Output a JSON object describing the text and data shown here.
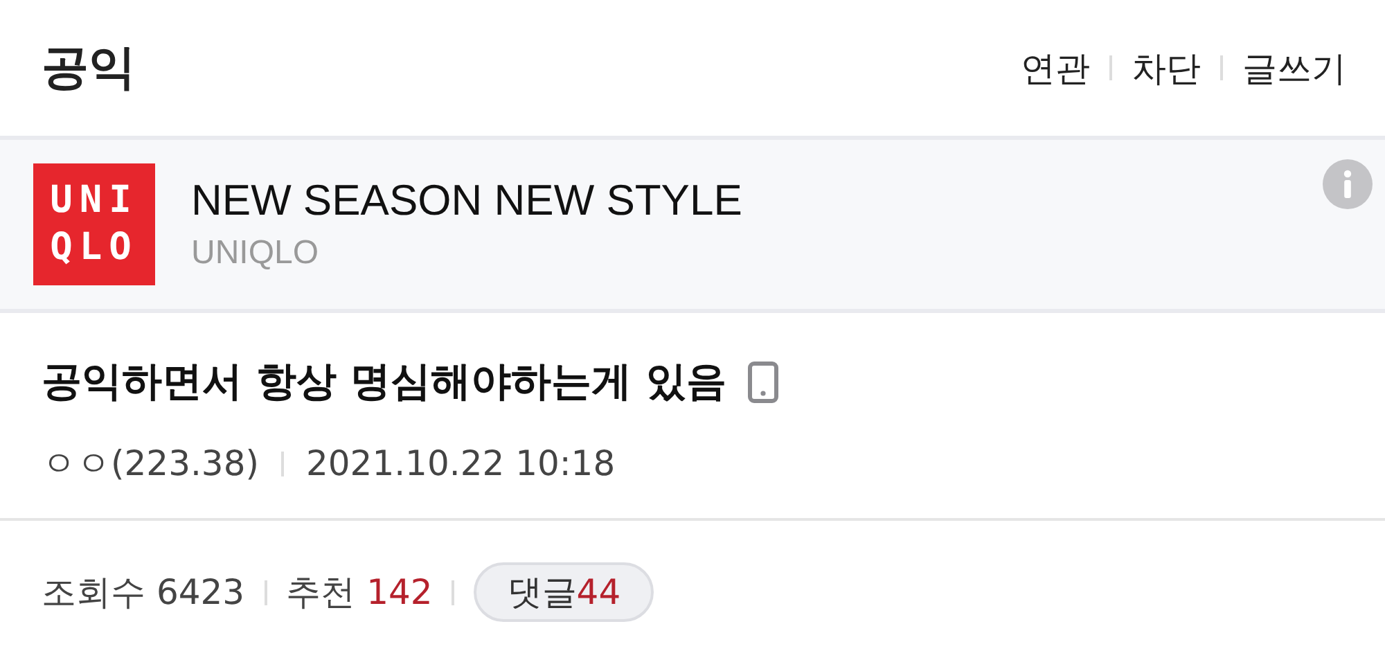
{
  "header": {
    "title": "공익",
    "actions": [
      "연관",
      "차단",
      "글쓰기"
    ]
  },
  "ad": {
    "logo_lines": [
      "UNI",
      "QLO"
    ],
    "headline": "NEW SEASON NEW STYLE",
    "advertiser": "UNIQLO"
  },
  "post": {
    "title": "공익하면서 항상 명심해야하는게 있음",
    "author": "ㅇㅇ(223.38)",
    "date": "2021.10.22 10:18"
  },
  "stats": {
    "views_label": "조회수",
    "views": "6423",
    "recommend_label": "추천",
    "recommend": "142",
    "comments_label": "댓글",
    "comments": "44"
  }
}
